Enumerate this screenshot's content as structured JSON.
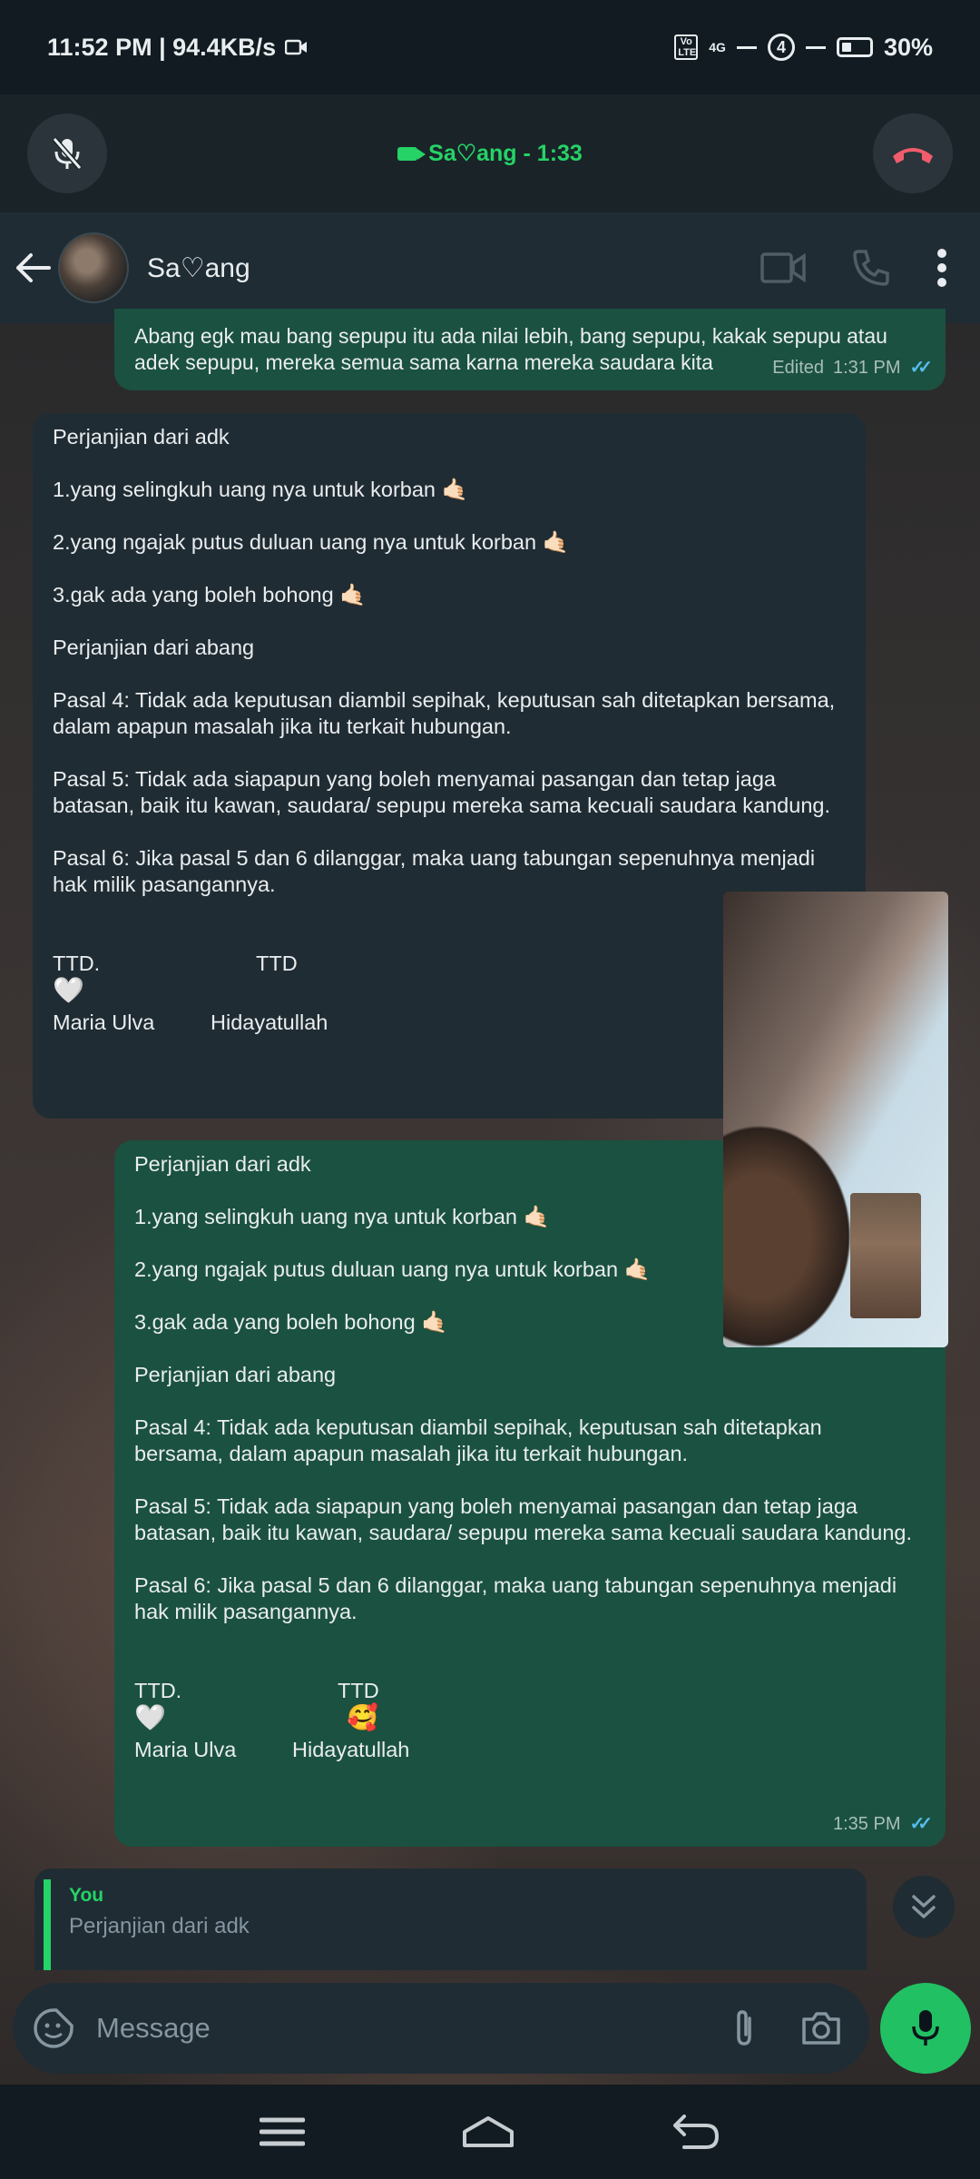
{
  "status_bar": {
    "time_speed": "11:52 PM | 94.4KB/s",
    "network": "4G",
    "volte": "Vo LTE",
    "sim_slot": "4",
    "battery": "30%"
  },
  "call": {
    "title": "Sa♡ang - 1:33"
  },
  "header": {
    "contact_name": "Sa♡ang"
  },
  "messages": [
    {
      "direction": "outgoing",
      "text": "Abang egk mau bang sepupu itu ada nilai lebih, bang sepupu, kakak sepupu atau\nadek sepupu, mereka semua sama karna mereka saudara kita",
      "edited": "Edited",
      "time": "1:31 PM"
    },
    {
      "direction": "incoming",
      "text": "Perjanjian dari adk\n\n1.yang selingkuh uang nya untuk korban 🤙🏻\n\n2.yang ngajak putus duluan uang nya untuk korban 🤙🏻\n\n3.gak ada yang boleh bohong 🤙🏻\n\nPerjanjian dari abang\n\nPasal 4: Tidak ada keputusan diambil sepihak, keputusan sah ditetapkan bersama,\ndalam apapun masalah jika itu terkait hubungan.\n\nPasal 5: Tidak ada siapapun yang boleh menyamai pasangan dan tetap jaga\nbatasan, baik itu kawan, saudara/ sepupu mereka sama kecuali saudara kandung.\n\nPasal 6: Jika pasal 5 dan 6 dilanggar, maka uang tabungan sepenuhnya menjadi\nhak milik pasangannya.",
      "sig_label_left": "TTD.",
      "sig_label_right": "TTD",
      "sig_mark_left": "🤍",
      "sig_mark_right": "",
      "sig_name_left": "Maria Ulva",
      "sig_name_right": "Hidayatullah"
    },
    {
      "direction": "outgoing",
      "text": "Perjanjian dari adk\n\n1.yang selingkuh uang nya untuk korban 🤙🏻\n\n2.yang ngajak putus duluan uang nya untuk korban 🤙🏻\n\n3.gak ada yang boleh bohong 🤙🏻\n\nPerjanjian dari abang\n\nPasal 4: Tidak ada keputusan diambil sepihak, keputusan sah ditetapkan\nbersama, dalam apapun masalah jika itu terkait hubungan.\n\nPasal 5: Tidak ada siapapun yang boleh menyamai pasangan dan tetap jaga\nbatasan, baik itu kawan, saudara/ sepupu mereka sama kecuali saudara kandung.\n\nPasal 6: Jika pasal 5 dan 6 dilanggar, maka uang tabungan sepenuhnya menjadi\nhak milik pasangannya.",
      "sig_label_left": "TTD.",
      "sig_label_right": "TTD",
      "sig_mark_left": "🤍",
      "sig_mark_right": "🥰",
      "sig_name_left": "Maria Ulva",
      "sig_name_right": "Hidayatullah",
      "time": "1:35 PM"
    }
  ],
  "reply_preview": {
    "author": "You",
    "text": "Perjanjian dari adk"
  },
  "composer": {
    "placeholder": "Message"
  },
  "colors": {
    "accent": "#25d366",
    "outgoing_bubble": "#1b5140",
    "incoming_bubble": "#202c33",
    "end_call": "#f15c6d",
    "read_ticks": "#53bdeb"
  },
  "icons": [
    "mute-mic-icon",
    "video-call-icon",
    "end-call-icon",
    "back-arrow-icon",
    "video-icon",
    "phone-icon",
    "more-vert-icon",
    "scroll-down-icon",
    "sticker-icon",
    "attach-icon",
    "camera-icon",
    "mic-icon",
    "menu-nav-icon",
    "home-nav-icon",
    "back-nav-icon"
  ]
}
